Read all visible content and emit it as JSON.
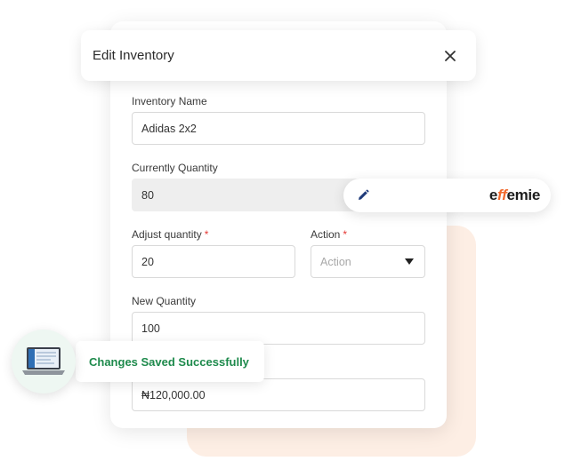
{
  "header": {
    "title": "Edit Inventory",
    "close_icon": "close-icon"
  },
  "form": {
    "inventory_name": {
      "label": "Inventory Name",
      "value": "Adidas 2x2"
    },
    "current_quantity": {
      "label": "Currently Quantity",
      "value": "80"
    },
    "adjust_quantity": {
      "label": "Adjust quantity",
      "required_mark": "*",
      "value": "20"
    },
    "action": {
      "label": "Action",
      "required_mark": "*",
      "placeholder": "Action"
    },
    "new_quantity": {
      "label": "New Quantity",
      "value": "100"
    },
    "price": {
      "value": "₦120,000.00"
    }
  },
  "brand": {
    "logo_text": "effemie",
    "logo_prefix": "e",
    "logo_mark": "ff",
    "logo_suffix": "emie",
    "edit_icon": "pencil-icon"
  },
  "toast": {
    "message": "Changes Saved Successfully",
    "icon": "laptop-icon"
  },
  "colors": {
    "success": "#1e8a4c",
    "accent_peach": "#fdeee4",
    "required": "#e53935",
    "brand_orange": "#f26a2e",
    "brand_blue": "#2b5fb8"
  }
}
